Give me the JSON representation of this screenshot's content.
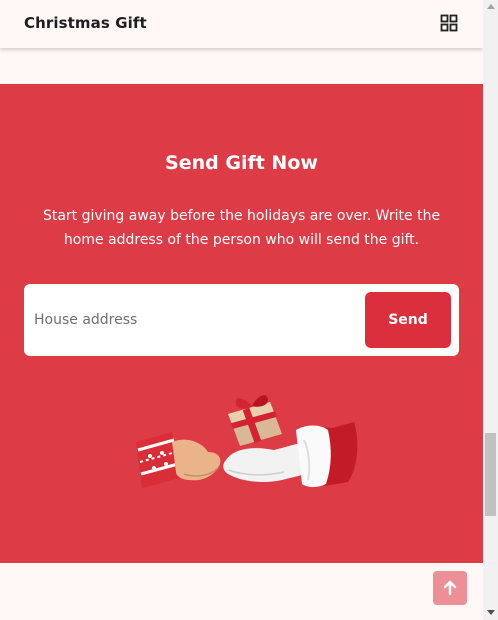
{
  "header": {
    "brand": "Christmas Gift",
    "menu_icon": "grid-icon"
  },
  "gift_section": {
    "title": "Send Gift Now",
    "description": "Start giving away before the holidays are over. Write the home address of the person who will send the gift.",
    "address_placeholder": "House address",
    "address_value": "",
    "send_label": "Send",
    "illustration_icon": "gift-handoff-illustration"
  },
  "back_to_top": {
    "icon": "arrow-up-icon"
  },
  "colors": {
    "section_bg": "#dd3b46",
    "button_bg": "#dc2f3d",
    "back_to_top_bg": "#ec8f96",
    "page_bg": "#fff8f6"
  }
}
